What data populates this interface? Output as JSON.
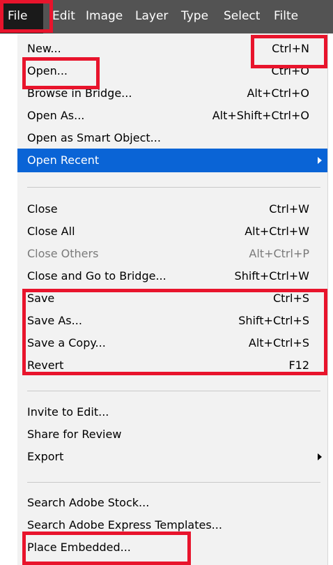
{
  "menubar": {
    "items": [
      {
        "label": "File"
      },
      {
        "label": "Edit"
      },
      {
        "label": "Image"
      },
      {
        "label": "Layer"
      },
      {
        "label": "Type"
      },
      {
        "label": "Select"
      },
      {
        "label": "Filte"
      }
    ]
  },
  "file_menu": {
    "groups": [
      {
        "items": [
          {
            "label": "New...",
            "shortcut": "Ctrl+N"
          },
          {
            "label": "Open...",
            "shortcut": "Ctrl+O"
          },
          {
            "label": "Browse in Bridge...",
            "shortcut": "Alt+Ctrl+O"
          },
          {
            "label": "Open As...",
            "shortcut": "Alt+Shift+Ctrl+O"
          },
          {
            "label": "Open as Smart Object...",
            "shortcut": ""
          },
          {
            "label": "Open Recent",
            "shortcut": "",
            "submenu": true,
            "highlighted": true
          }
        ]
      },
      {
        "items": [
          {
            "label": "Close",
            "shortcut": "Ctrl+W"
          },
          {
            "label": "Close All",
            "shortcut": "Alt+Ctrl+W"
          },
          {
            "label": "Close Others",
            "shortcut": "Alt+Ctrl+P",
            "disabled": true
          },
          {
            "label": "Close and Go to Bridge...",
            "shortcut": "Shift+Ctrl+W"
          },
          {
            "label": "Save",
            "shortcut": "Ctrl+S"
          },
          {
            "label": "Save As...",
            "shortcut": "Shift+Ctrl+S"
          },
          {
            "label": "Save a Copy...",
            "shortcut": "Alt+Ctrl+S"
          },
          {
            "label": "Revert",
            "shortcut": "F12"
          }
        ]
      },
      {
        "items": [
          {
            "label": "Invite to Edit...",
            "shortcut": ""
          },
          {
            "label": "Share for Review",
            "shortcut": ""
          },
          {
            "label": "Export",
            "shortcut": "",
            "submenu": true
          }
        ]
      },
      {
        "items": [
          {
            "label": "Search Adobe Stock...",
            "shortcut": ""
          },
          {
            "label": "Search Adobe Express Templates...",
            "shortcut": ""
          },
          {
            "label": "Place Embedded...",
            "shortcut": ""
          }
        ]
      }
    ]
  },
  "colors": {
    "menubar_bg": "#535353",
    "menu_bg": "#f2f2f2",
    "highlight": "#0a64d6",
    "annotation": "#e8142c"
  }
}
